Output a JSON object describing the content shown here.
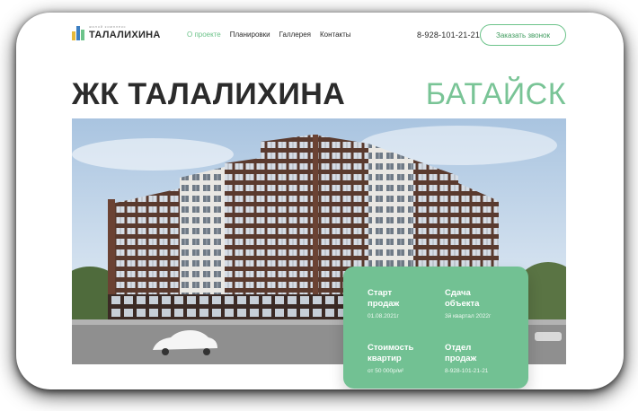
{
  "header": {
    "logo": {
      "subtitle": "жилой комплекс",
      "name": "ТАЛАЛИХИНА"
    },
    "nav": [
      {
        "label": "О проекте",
        "active": true
      },
      {
        "label": "Планировки",
        "active": false
      },
      {
        "label": "Галлерея",
        "active": false
      },
      {
        "label": "Контакты",
        "active": false
      }
    ],
    "phone": "8-928-101-21-21",
    "callback_button": "Заказать звонок"
  },
  "hero": {
    "title": "ЖК ТАЛАЛИХИНА",
    "city": "БАТАЙСК"
  },
  "info": [
    {
      "label": "Старт\nпродаж",
      "value": "01.08.2021г"
    },
    {
      "label": "Сдача\nобъекта",
      "value": "3й квартал 2022г"
    },
    {
      "label": "Стоимость\nквартир",
      "value": "от 50 000р/м²"
    },
    {
      "label": "Отдел\nпродаж",
      "value": "8-928-101-21-21"
    }
  ],
  "colors": {
    "accent": "#79c496",
    "info_bg": "#72c193",
    "text": "#2b2b2b"
  }
}
